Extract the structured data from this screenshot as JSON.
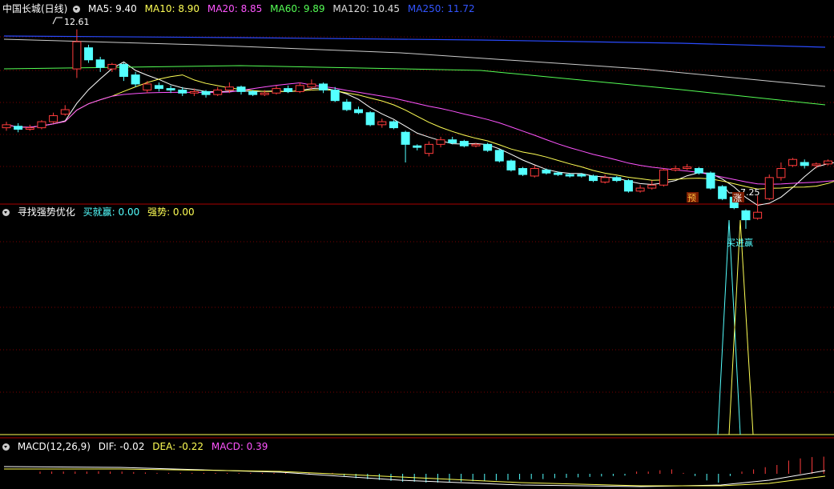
{
  "colors": {
    "up": "#ff3c3c",
    "down": "#54ffff",
    "ma5": "#ffffff",
    "ma10": "#ffff55",
    "ma20": "#ff55ff",
    "ma60": "#55ff55",
    "ma120": "#cccccc",
    "ma250": "#2a4bff",
    "grid": "#7a0000",
    "separator": "#aa0000"
  },
  "panel_main": {
    "stock_title": "中国长城(日线)",
    "ma5": "MA5: 9.40",
    "ma10": "MA10: 8.90",
    "ma20": "MA20: 8.85",
    "ma60": "MA60: 9.89",
    "ma120": "MA120: 10.45",
    "ma250": "MA250: 11.72",
    "high_label": "12.61",
    "low_label": "7.25",
    "marker_1": "预",
    "marker_2": "涨"
  },
  "panel_indicator": {
    "title": "寻找强势优化",
    "buy_label": "买就赢: 0.00",
    "strong_label": "强势: 0.00",
    "signal_text": "买进赢"
  },
  "panel_macd": {
    "title": "MACD(12,26,9)",
    "dif": "DIF: -0.02",
    "dea": "DEA: -0.22",
    "macd": "MACD: 0.39"
  },
  "chart_data": {
    "type": "candlestick",
    "y_range": [
      6.9,
      13.0
    ],
    "candles": [
      [
        9.35,
        9.45,
        9.55,
        9.25
      ],
      [
        9.4,
        9.3,
        9.5,
        9.2
      ],
      [
        9.3,
        9.35,
        9.45,
        9.25
      ],
      [
        9.35,
        9.55,
        9.6,
        9.3
      ],
      [
        9.55,
        9.75,
        9.85,
        9.5
      ],
      [
        9.8,
        9.95,
        10.1,
        9.75
      ],
      [
        11.3,
        12.2,
        12.61,
        11.0
      ],
      [
        12.0,
        11.6,
        12.1,
        11.5
      ],
      [
        11.6,
        11.35,
        11.7,
        11.2
      ],
      [
        11.3,
        11.45,
        11.5,
        11.2
      ],
      [
        11.45,
        11.05,
        11.5,
        10.9
      ],
      [
        11.1,
        10.8,
        11.2,
        10.7
      ],
      [
        10.6,
        10.8,
        10.9,
        10.5
      ],
      [
        10.75,
        10.65,
        10.85,
        10.55
      ],
      [
        10.65,
        10.6,
        10.75,
        10.5
      ],
      [
        10.6,
        10.5,
        10.7,
        10.4
      ],
      [
        10.5,
        10.55,
        10.65,
        10.4
      ],
      [
        10.55,
        10.45,
        10.6,
        10.35
      ],
      [
        10.45,
        10.6,
        10.7,
        10.4
      ],
      [
        10.6,
        10.7,
        10.85,
        10.5
      ],
      [
        10.7,
        10.55,
        10.75,
        10.45
      ],
      [
        10.55,
        10.45,
        10.6,
        10.4
      ],
      [
        10.45,
        10.5,
        10.6,
        10.4
      ],
      [
        10.5,
        10.65,
        10.75,
        10.45
      ],
      [
        10.65,
        10.55,
        10.75,
        10.5
      ],
      [
        10.55,
        10.75,
        10.85,
        10.5
      ],
      [
        10.7,
        10.8,
        10.95,
        10.6
      ],
      [
        10.8,
        10.6,
        10.85,
        10.5
      ],
      [
        10.6,
        10.25,
        10.7,
        10.2
      ],
      [
        10.2,
        9.95,
        10.3,
        9.9
      ],
      [
        9.95,
        9.85,
        10.05,
        9.8
      ],
      [
        9.85,
        9.45,
        9.9,
        9.4
      ],
      [
        9.45,
        9.55,
        9.65,
        9.35
      ],
      [
        9.55,
        9.35,
        9.6,
        9.3
      ],
      [
        9.2,
        8.8,
        9.25,
        8.2
      ],
      [
        8.75,
        8.7,
        8.8,
        8.6
      ],
      [
        8.5,
        8.8,
        8.9,
        8.4
      ],
      [
        8.8,
        8.95,
        9.05,
        8.7
      ],
      [
        8.95,
        8.85,
        9.05,
        8.8
      ],
      [
        8.9,
        8.75,
        8.95,
        8.7
      ],
      [
        8.75,
        8.8,
        8.85,
        8.7
      ],
      [
        8.8,
        8.6,
        8.85,
        8.55
      ],
      [
        8.6,
        8.25,
        8.65,
        8.2
      ],
      [
        8.25,
        7.95,
        8.3,
        7.9
      ],
      [
        8.0,
        7.8,
        8.05,
        7.75
      ],
      [
        7.75,
        8.0,
        8.1,
        7.7
      ],
      [
        7.95,
        7.85,
        8.0,
        7.8
      ],
      [
        7.85,
        7.8,
        7.9,
        7.75
      ],
      [
        7.8,
        7.75,
        7.85,
        7.7
      ],
      [
        7.8,
        7.75,
        7.85,
        7.7
      ],
      [
        7.75,
        7.6,
        7.8,
        7.55
      ],
      [
        7.55,
        7.7,
        7.8,
        7.5
      ],
      [
        7.7,
        7.6,
        7.75,
        7.55
      ],
      [
        7.6,
        7.25,
        7.65,
        7.2
      ],
      [
        7.25,
        7.35,
        7.45,
        7.2
      ],
      [
        7.35,
        7.45,
        7.6,
        7.3
      ],
      [
        7.45,
        7.95,
        8.0,
        7.4
      ],
      [
        7.95,
        8.0,
        8.1,
        7.9
      ],
      [
        8.0,
        8.05,
        8.15,
        7.95
      ],
      [
        8.0,
        7.85,
        8.05,
        7.8
      ],
      [
        7.85,
        7.35,
        7.9,
        7.3
      ],
      [
        7.4,
        7.0,
        7.45,
        6.95
      ],
      [
        7.05,
        6.7,
        7.1,
        6.65
      ],
      [
        6.6,
        6.3,
        6.65,
        6.0
      ],
      [
        6.35,
        6.55,
        7.1,
        6.3
      ],
      [
        7.0,
        7.7,
        7.8,
        6.95
      ],
      [
        7.7,
        8.0,
        8.2,
        7.6
      ],
      [
        8.1,
        8.3,
        8.35,
        8.05
      ],
      [
        8.2,
        8.1,
        8.3,
        8.0
      ],
      [
        8.1,
        8.15,
        8.2,
        8.0
      ],
      [
        8.15,
        8.25,
        8.3,
        8.1
      ],
      [
        8.25,
        8.35,
        8.45,
        8.2
      ],
      [
        8.3,
        8.4,
        8.9,
        8.25
      ]
    ],
    "macd_hist": [
      0.05,
      0.05,
      0.05,
      0.05,
      0.05,
      0.06,
      0.05,
      0.05,
      0.04,
      0.03,
      0.02,
      0.02,
      0.02,
      0.02,
      0.02,
      0.02,
      0.02,
      0.02,
      0.02,
      0.02,
      0.02,
      0.02,
      0.02,
      0.02,
      0.02,
      0.02,
      -0.05,
      -0.1,
      -0.12,
      -0.14,
      -0.16,
      -0.18,
      -0.18,
      -0.2,
      -0.2,
      -0.19,
      -0.18,
      -0.17,
      -0.16,
      -0.15,
      -0.14,
      -0.13,
      -0.12,
      -0.12,
      -0.1,
      -0.09,
      -0.08,
      -0.07,
      -0.06,
      -0.05,
      -0.04,
      0.05,
      0.05,
      0.08,
      0.1,
      0.02,
      -0.05,
      -0.15,
      -0.2,
      -0.05,
      0.05,
      0.1,
      0.15,
      0.2,
      0.3,
      0.35,
      0.38,
      0.39
    ]
  }
}
